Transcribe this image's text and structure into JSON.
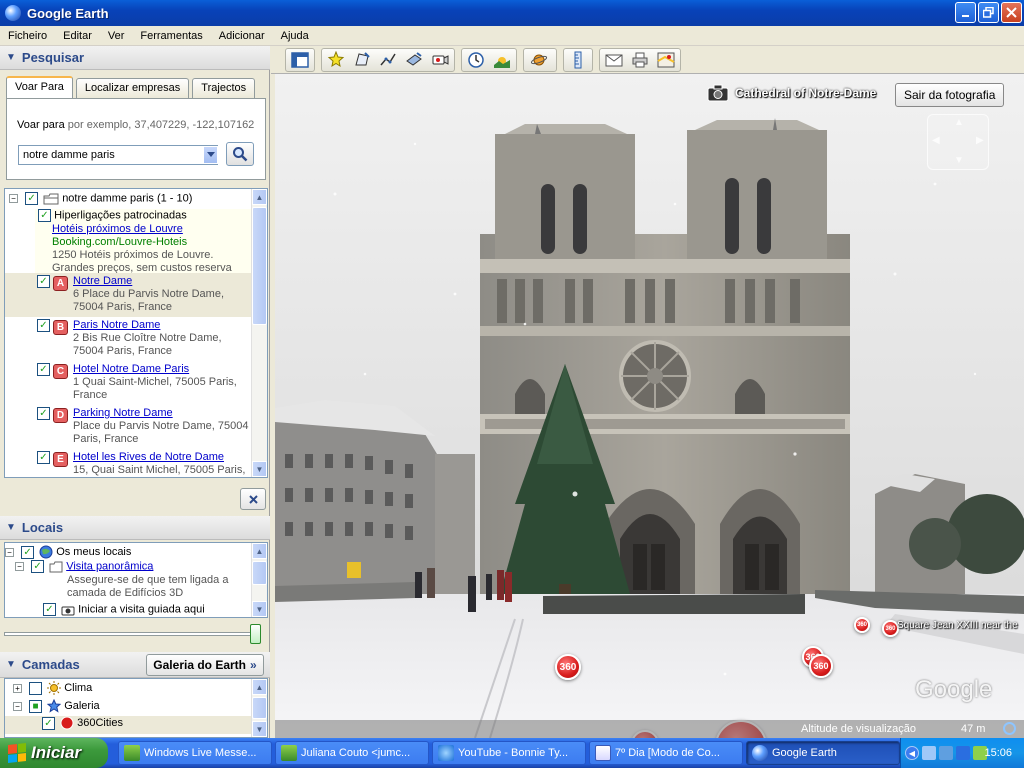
{
  "window": {
    "title": "Google Earth"
  },
  "menu": [
    "Ficheiro",
    "Editar",
    "Ver",
    "Ferramentas",
    "Adicionar",
    "Ajuda"
  ],
  "search": {
    "header": "Pesquisar",
    "tabs": [
      "Voar Para",
      "Localizar empresas",
      "Trajectos"
    ],
    "hint_label": "Voar para",
    "hint_example": "por exemplo, 37,407229, -122,107162",
    "query": "notre damme paris"
  },
  "results": {
    "root": "notre damme paris (1 - 10)",
    "sponsored": {
      "title": "Hiperligações patrocinadas",
      "link": "Hotéis próximos de Louvre",
      "url": "Booking.com/Louvre-Hoteis",
      "line1": "1250 Hotéis próximos de Louvre.",
      "line2": "Grandes preços, sem custos reserva"
    },
    "items": [
      {
        "marker": "A",
        "title": "Notre Dame",
        "address": "6 Place du Parvis Notre Dame, 75004 Paris, France"
      },
      {
        "marker": "B",
        "title": "Paris Notre Dame",
        "address": "2 Bis Rue Cloître Notre Dame, 75004 Paris, France"
      },
      {
        "marker": "C",
        "title": "Hotel Notre Dame Paris",
        "address": "1 Quai Saint-Michel, 75005 Paris, France"
      },
      {
        "marker": "D",
        "title": "Parking Notre Dame",
        "address": "Place du Parvis Notre Dame, 75004 Paris, France"
      },
      {
        "marker": "E",
        "title": "Hotel les Rives de Notre Dame",
        "address": "15, Quai Saint Michel, 75005 Paris,"
      }
    ]
  },
  "places": {
    "header": "Locais",
    "my_places": "Os meus locais",
    "tour": "Visita panorâmica",
    "tour_desc1": "Assegure-se de que tem ligada a",
    "tour_desc2": "camada de Edifícios 3D",
    "start_tour": "Iniciar a visita guiada aqui"
  },
  "layers": {
    "header": "Camadas",
    "gallery_button": "Galeria do Earth",
    "items": [
      "Clima",
      "Galeria",
      "360Cities"
    ]
  },
  "viewport": {
    "photo_label": "Cathedral of Notre-Dame",
    "exit_button": "Sair da fotografia",
    "street_label": "Square Jean XXIII near the",
    "badge_text": "360",
    "google_logo": "Google",
    "altitude_label": "Altitude de visualização",
    "altitude_value": "47 m"
  },
  "taskbar": {
    "start": "Iniciar",
    "items": [
      "Windows Live Messe...",
      "Juliana Couto <jumc...",
      "YouTube - Bonnie Ty...",
      "7º Dia [Modo de Co...",
      "Google Earth"
    ],
    "clock": "15:06"
  },
  "colors": {
    "title_bar": "#0a5fd8",
    "panel_header_text": "#2c4a8a",
    "link": "#0000cc",
    "marker": "#e46060",
    "badge": "#d81c1c",
    "taskbar": "#245edb"
  }
}
